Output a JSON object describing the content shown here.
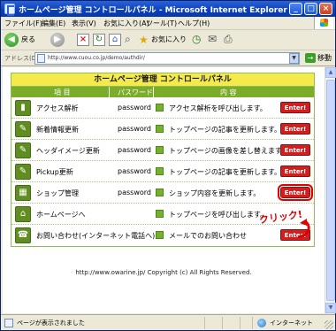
{
  "window": {
    "title": "ホームページ管理 コントロールパネル - Microsoft Internet Explorer",
    "min_label": "_",
    "max_label": "□",
    "close_label": "×"
  },
  "menu": {
    "items": [
      "ファイル(F)",
      "編集(E)",
      "表示(V)",
      "お気に入り(A)",
      "ツール(T)",
      "ヘルプ(H)"
    ]
  },
  "toolbar": {
    "back_label": "戻る",
    "favorites_label": "お気に入り",
    "back_glyph": "◀",
    "forward_glyph": "▶",
    "stop_glyph": "×",
    "refresh_glyph": "↻",
    "home_glyph": "⌂",
    "search_glyph": "⌕",
    "favorites_glyph": "★",
    "history_glyph": "◷",
    "mail_glyph": "✉",
    "print_glyph": "⎙"
  },
  "address": {
    "label": "アドレス(D)",
    "url": "http://www.cuou.co.jp/demo/authdir/",
    "go_label": "移動",
    "go_glyph": "→",
    "drop_glyph": "▼"
  },
  "panel": {
    "title": "ホームページ管理 コントロールパネル",
    "col_item": "項 目",
    "col_password": "パスワード",
    "col_content": "内 容",
    "rows": [
      {
        "title": "アクセス解析",
        "password": "password",
        "desc": "アクセス解析を呼び出します。",
        "button": "Enter!",
        "icon": "chart-icon",
        "glyph": "▮"
      },
      {
        "title": "新着情報更新",
        "password": "password",
        "desc": "トップページの記事を更新します。",
        "button": "Enter!",
        "icon": "pen-icon",
        "glyph": "✎"
      },
      {
        "title": "ヘッダイメージ更新",
        "password": "password",
        "desc": "トップページの画像を差し替えます。",
        "button": "Enter!",
        "icon": "pen-icon",
        "glyph": "✎"
      },
      {
        "title": "Pickup更新",
        "password": "password",
        "desc": "トップページの記事を更新します。",
        "button": "Enter!",
        "icon": "pen-icon",
        "glyph": "✎"
      },
      {
        "title": "ショップ管理",
        "password": "password",
        "desc": "ショップ内容を更新します。",
        "button": "Enter!",
        "icon": "cart-icon",
        "glyph": "▦"
      },
      {
        "title": "ホームページへ",
        "password": "",
        "desc": "トップページを呼び出します。",
        "button": "",
        "icon": "home-icon",
        "glyph": "⌂"
      },
      {
        "title": "お問い合わせ(インターネット電話へ)",
        "password": "",
        "desc": "メールでのお問い合わせ",
        "button": "Enter!",
        "icon": "contact-icon",
        "glyph": "☎"
      }
    ]
  },
  "annotation": {
    "click_label": "クリック!"
  },
  "footer": {
    "copyright": "http://www.owarine.jp/ Copyright (c) All Rights Reserved."
  },
  "status": {
    "text": "ページが表示されました",
    "zone": "インターネット"
  },
  "colors": {
    "header_yellow": "#f5ea4c",
    "column_green": "#7cad2a",
    "enter_red": "#cf1f1f",
    "titlebar_blue": "#0a3fb8"
  }
}
